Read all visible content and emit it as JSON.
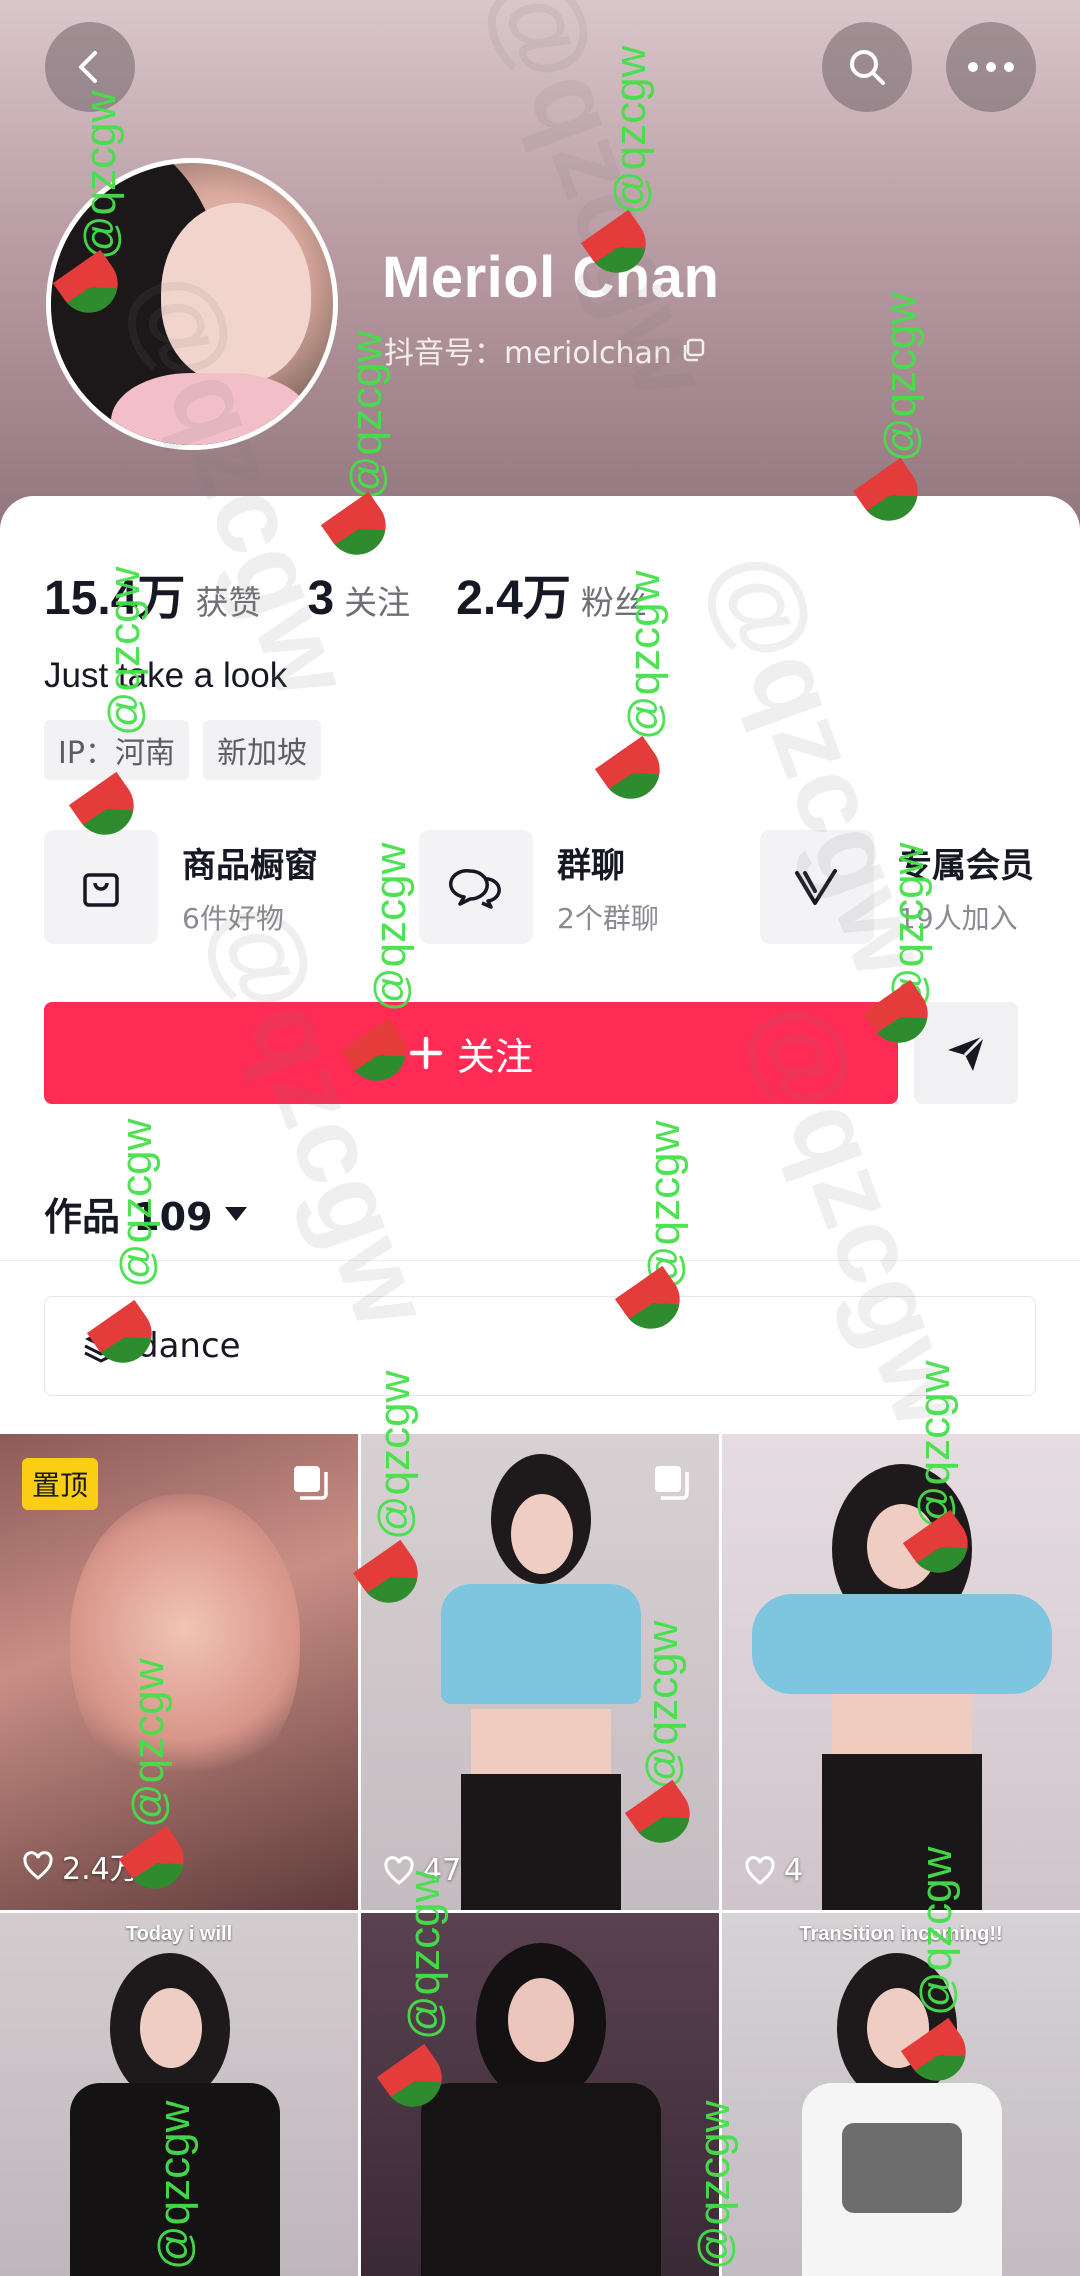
{
  "profile": {
    "nickname": "Meriol Chan",
    "douyin_id": "抖音号：meriolchan",
    "bio": "Just take a look",
    "tags": [
      "IP：河南",
      "新加坡"
    ]
  },
  "stats": [
    {
      "num": "15.4万",
      "label": "获赞"
    },
    {
      "num": "3",
      "label": "关注"
    },
    {
      "num": "2.4万",
      "label": "粉丝"
    }
  ],
  "services": [
    {
      "title": "商品橱窗",
      "sub": "6件好物",
      "icon": "shopping-bag-icon"
    },
    {
      "title": "群聊",
      "sub": "2个群聊",
      "icon": "chat-bubbles-icon"
    },
    {
      "title": "专属会员",
      "sub": "19人加入",
      "icon": "vip-v-icon"
    }
  ],
  "actions": {
    "follow_label": "关注"
  },
  "works": {
    "tab_label": "作品 109",
    "collection_label": "dance"
  },
  "grid": [
    {
      "pin": "置顶",
      "likes": "2.4万",
      "multi": true,
      "caption": ""
    },
    {
      "pin": "",
      "likes": "47",
      "multi": true,
      "caption": ""
    },
    {
      "pin": "",
      "likes": "4",
      "multi": false,
      "caption": ""
    },
    {
      "pin": "",
      "likes": "",
      "multi": false,
      "caption": "Today i will"
    },
    {
      "pin": "",
      "likes": "",
      "multi": false,
      "caption": ""
    },
    {
      "pin": "",
      "likes": "",
      "multi": false,
      "caption": "Transition incoming!!"
    }
  ],
  "watermark": {
    "text": "@qzcgw"
  },
  "colors": {
    "accent": "#fe2c55",
    "pin_badge": "#face15",
    "watermark_green": "#45e04a"
  }
}
